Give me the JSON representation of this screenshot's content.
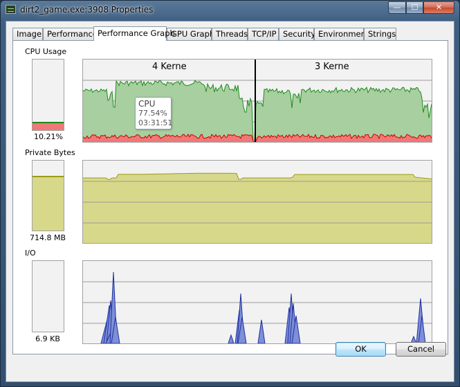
{
  "window": {
    "title": "dirt2_game.exe:3908 Properties",
    "min_glyph": "—",
    "max_glyph": "☐",
    "close_glyph": "✕"
  },
  "tabs": [
    {
      "label": "Image"
    },
    {
      "label": "Performance"
    },
    {
      "label": "Performance Graph"
    },
    {
      "label": "GPU Graph"
    },
    {
      "label": "Threads"
    },
    {
      "label": "TCP/IP"
    },
    {
      "label": "Security"
    },
    {
      "label": "Environment"
    },
    {
      "label": "Strings"
    }
  ],
  "active_tab": "Performance Graph",
  "cpu": {
    "label": "CPU Usage",
    "value_text": "10.21%",
    "value_fraction": 0.1021,
    "core_left_label": "4 Kerne",
    "core_right_label": "3 Kerne",
    "tooltip": {
      "title": "CPU",
      "value": "77.54%",
      "time": "03:31:51"
    }
  },
  "private_bytes": {
    "label": "Private Bytes",
    "value_text": "714.8 MB",
    "fill_fraction": 0.76
  },
  "io": {
    "label": "I/O",
    "value_text": "6.9  KB"
  },
  "buttons": {
    "ok": "OK",
    "cancel": "Cancel"
  },
  "colors": {
    "cpu_fill": "#a8cfa0",
    "cpu_line": "#1c8a1c",
    "kernel_fill": "#f07878",
    "kernel_line": "#cc0000",
    "bytes_fill": "#d8d88a",
    "bytes_line": "#9a9a18",
    "io_fill": "#7d8fd8",
    "io_line": "#1f2f9e",
    "grid": "#9a9a9a"
  }
}
